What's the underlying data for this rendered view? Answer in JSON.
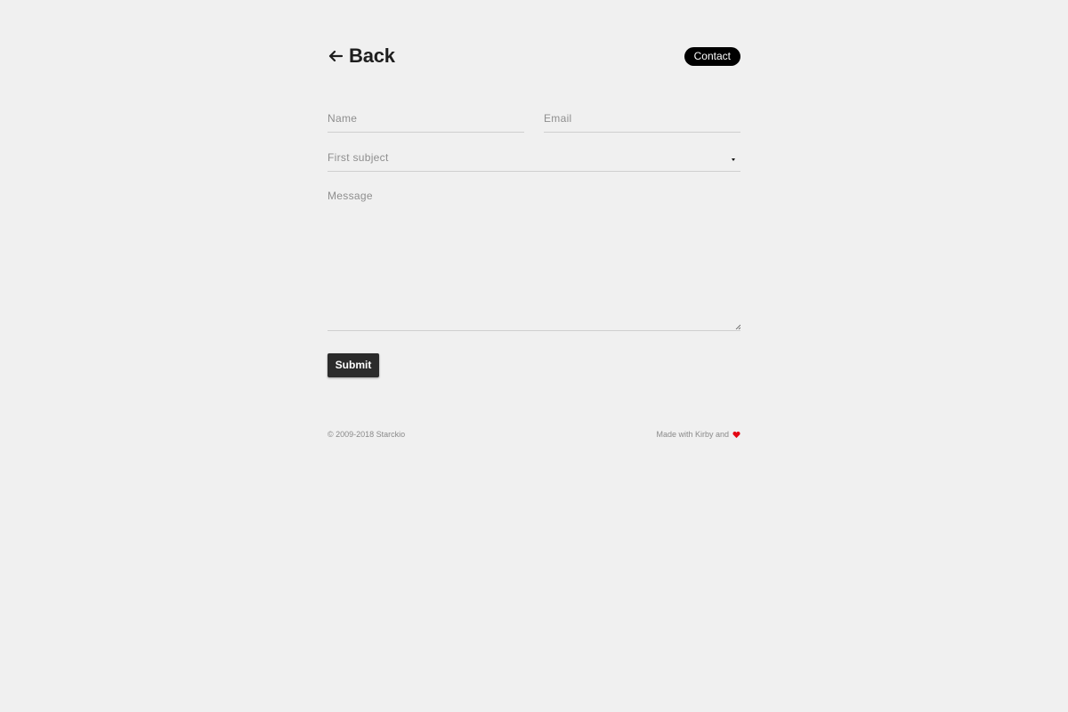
{
  "header": {
    "back_label": "Back",
    "contact_label": "Contact"
  },
  "form": {
    "name_placeholder": "Name",
    "email_placeholder": "Email",
    "subject_selected": "First subject",
    "message_placeholder": "Message",
    "submit_label": "Submit"
  },
  "footer": {
    "copyright": "© 2009-2018 Starckio",
    "made_with": "Made with Kirby and"
  },
  "icons": {
    "back": "arrow-left-icon",
    "select": "chevron-down-icon",
    "resize": "resize-grip-icon",
    "heart": "heart-icon"
  },
  "colors": {
    "background": "#f0f0f0",
    "text": "#222222",
    "pill": "#000000",
    "button": "#2b2b2b",
    "heart": "#e30613"
  }
}
